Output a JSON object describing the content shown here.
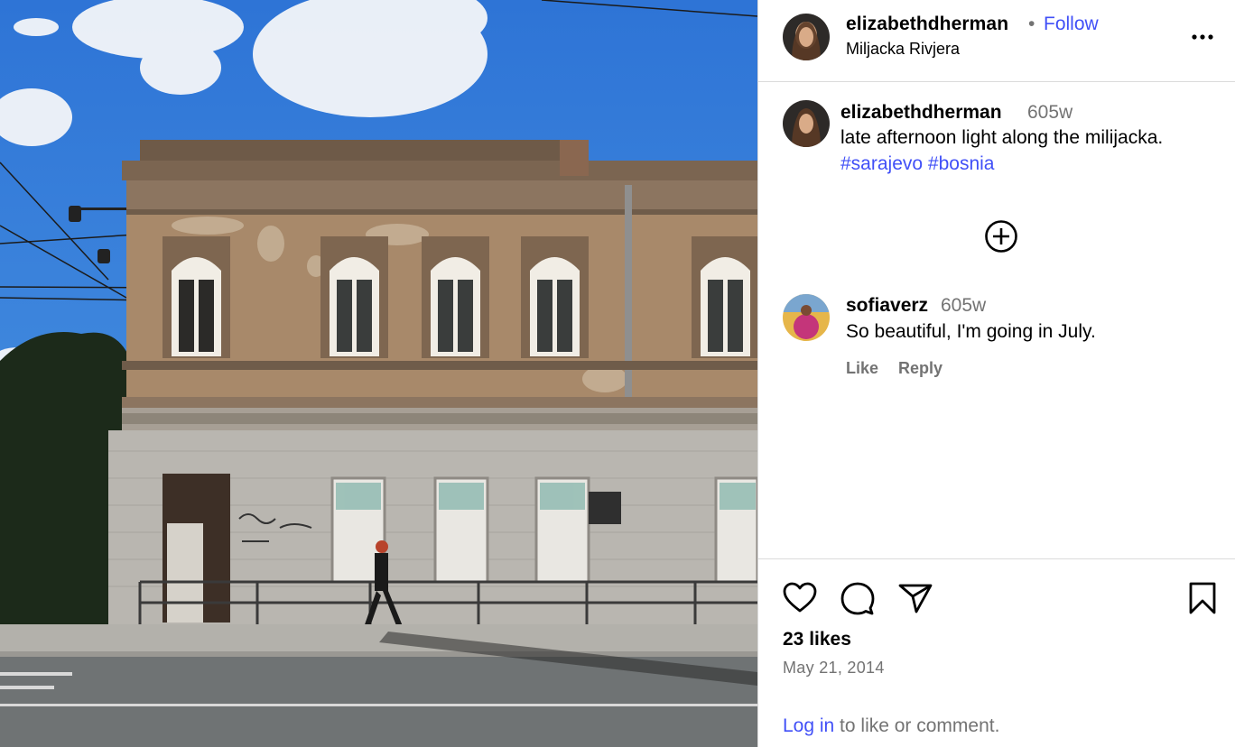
{
  "post": {
    "photo_alt": "",
    "username": "elizabethdherman",
    "separator": "•",
    "follow_label": "Follow",
    "location": "Miljacka Rivjera"
  },
  "caption": {
    "username": "elizabethdherman",
    "time": "605w",
    "text": "late afternoon light along the milijacka.",
    "hashtags": [
      "#sarajevo",
      "#bosnia"
    ]
  },
  "comments": [
    {
      "username": "sofiaverz",
      "time": "605w",
      "text": "So beautiful, I'm going in July.",
      "like_label": "Like",
      "reply_label": "Reply"
    }
  ],
  "actions": {
    "icons": [
      "heart-icon",
      "comment-icon",
      "share-icon",
      "bookmark-icon"
    ]
  },
  "stats": {
    "likes": "23 likes",
    "date": "May 21, 2014"
  },
  "footer": {
    "login_link": "Log in",
    "login_text": " to like or comment."
  },
  "colors": {
    "link_blue": "#4150f7",
    "muted_gray": "#737373",
    "divider": "#dbdbdb"
  }
}
